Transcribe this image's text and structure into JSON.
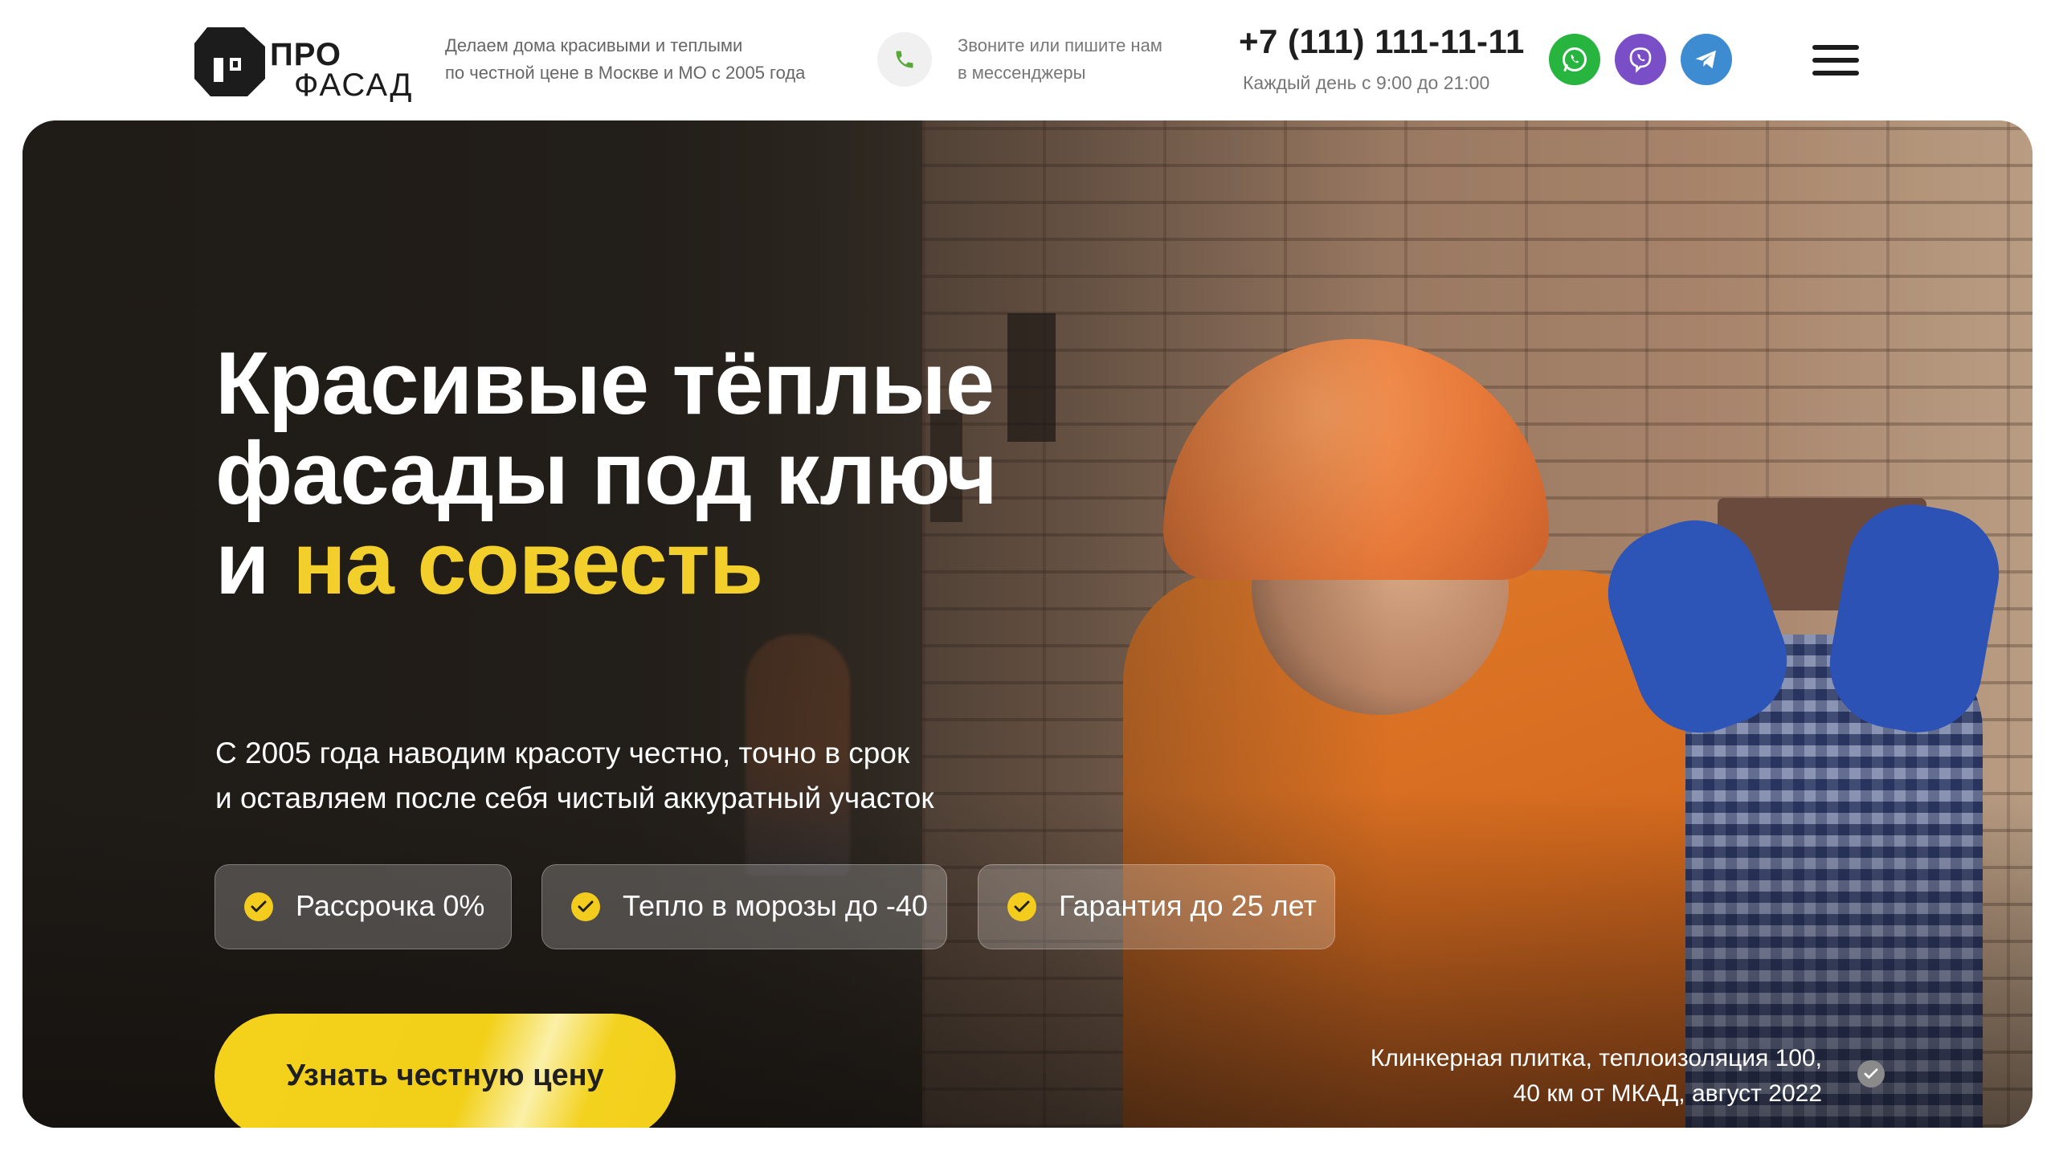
{
  "header": {
    "logo_top": "ПРО",
    "logo_bottom": "ФАСАД",
    "tagline": "Делаем дома красивыми и теплыми\nпо честной цене в Москве и МО с 2005 года",
    "contact_note": "Звоните или пишите нам\nв мессенджеры",
    "phone": "+7 (111) 111-11-11",
    "hours": "Каждый день с 9:00 до 21:00",
    "icons": [
      "phone-icon",
      "whatsapp-icon",
      "viber-icon",
      "telegram-icon",
      "menu-icon"
    ],
    "colors": {
      "whatsapp": "#27b43f",
      "viber": "#7a4ec6",
      "telegram": "#3d8bd0"
    }
  },
  "hero": {
    "headline_white": "Красивые тёплые фасады под ключ и ",
    "headline_accent": "на совесть",
    "subtitle": "С 2005 года наводим красоту честно, точно в срок\nи оставляем после себя чистый аккуратный участок",
    "badges": [
      {
        "label": "Рассрочка 0%"
      },
      {
        "label": "Тепло в морозы до -40"
      },
      {
        "label": "Гарантия до 25 лет"
      }
    ],
    "cta_label": "Узнать честную цену",
    "photo_caption": "Клинкерная плитка, теплоизоляция 100,\n40 км от МКАД, август 2022",
    "colors": {
      "accent": "#f2cf2a",
      "cta": "#f4d21c"
    }
  }
}
